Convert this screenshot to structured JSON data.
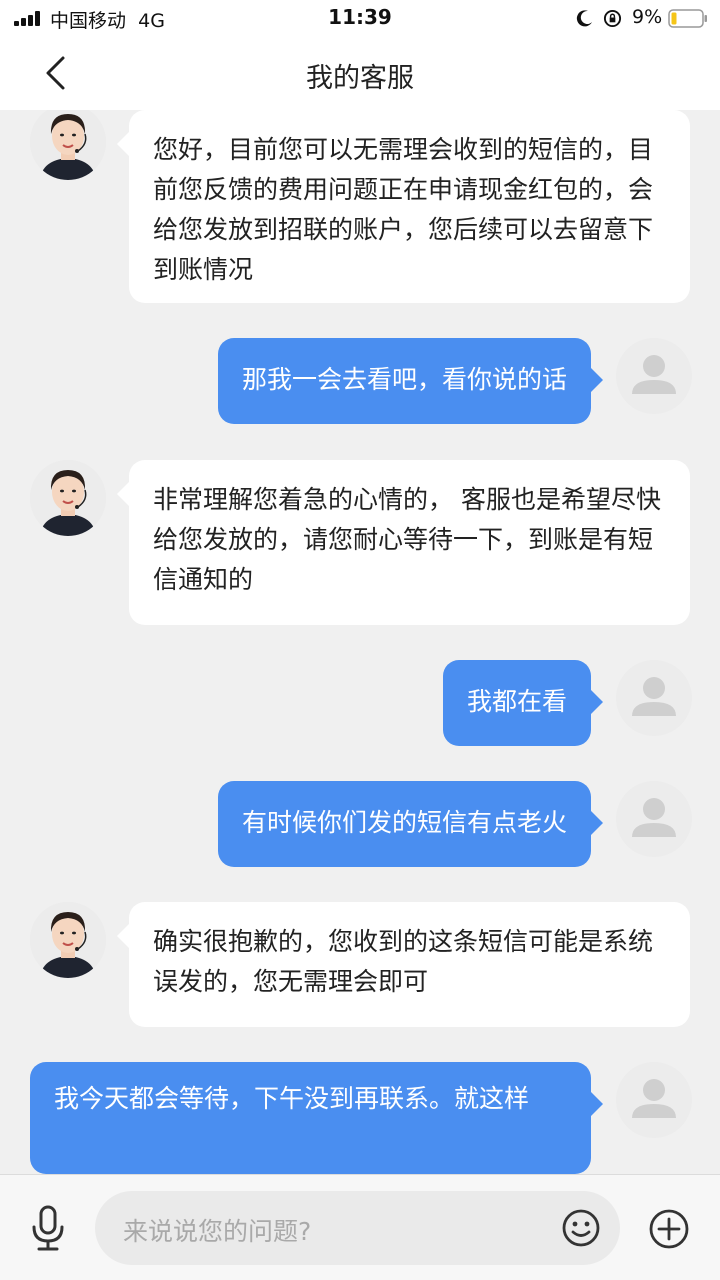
{
  "status_bar": {
    "carrier": "中国移动",
    "network": "4G",
    "time": "11:39",
    "battery": "9%"
  },
  "nav": {
    "title": "我的客服",
    "back_icon": "chevron-left-icon"
  },
  "messages": [
    {
      "sender": "agent",
      "text": "您好，目前您可以无需理会收到的短信的，目前您反馈的费用问题正在申请现金红包的，会给您发放到招联的账户，您后续可以去留意下到账情况"
    },
    {
      "sender": "user",
      "text": "那我一会去看吧，看你说的话"
    },
    {
      "sender": "agent",
      "text": "非常理解您着急的心情的， 客服也是希望尽快给您发放的，请您耐心等待一下，到账是有短信通知的"
    },
    {
      "sender": "user",
      "text": "我都在看"
    },
    {
      "sender": "user",
      "text": "有时候你们发的短信有点老火"
    },
    {
      "sender": "agent",
      "text": "确实很抱歉的，您收到的这条短信可能是系统误发的，您无需理会即可"
    },
    {
      "sender": "user",
      "text": "我今天都会等待，下午没到再联系。就这样"
    }
  ],
  "input": {
    "placeholder": "来说说您的问题?",
    "mic_icon": "microphone-icon",
    "emoji_icon": "emoji-icon",
    "plus_icon": "plus-circle-icon"
  },
  "colors": {
    "user_bubble": "#4a8ef0",
    "agent_bubble": "#ffffff",
    "background": "#f0f0f0"
  }
}
